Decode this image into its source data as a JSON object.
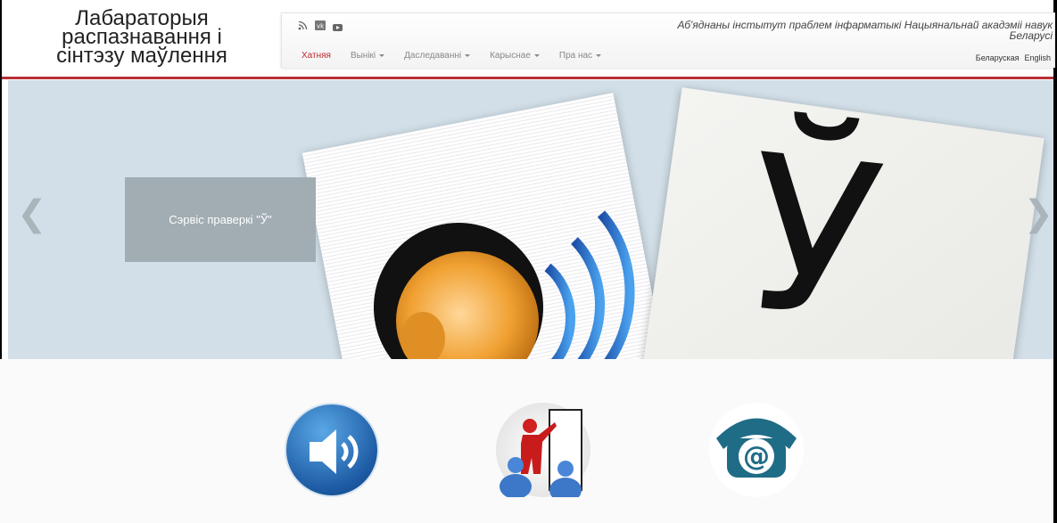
{
  "brand": {
    "line1": "Лабараторыя",
    "line2": "распазнавання і",
    "line3": "сінтэзу маўлення"
  },
  "institute": {
    "line1": "Аб'яднаны інстытут праблем інфарматыкі Нацыянальнай акадэміі навук",
    "line2": "Беларусі"
  },
  "social_icons": [
    "rss-icon",
    "vk-icon",
    "youtube-icon"
  ],
  "nav": {
    "items": [
      {
        "label": "Хатняя",
        "active": true,
        "dropdown": false
      },
      {
        "label": "Вынікі",
        "active": false,
        "dropdown": true
      },
      {
        "label": "Даследаванні",
        "active": false,
        "dropdown": true
      },
      {
        "label": "Карыснае",
        "active": false,
        "dropdown": true
      },
      {
        "label": "Пра нас",
        "active": false,
        "dropdown": true
      }
    ]
  },
  "languages": [
    "Беларуская",
    "English"
  ],
  "carousel": {
    "caption": "Сэрвіс праверкі \"Ў\"",
    "prev_label": "❮",
    "next_label": "❯",
    "slide_letter": "Ў"
  },
  "services": [
    {
      "icon": "speaker-icon"
    },
    {
      "icon": "lecturer-icon"
    },
    {
      "icon": "email-phone-icon"
    }
  ],
  "colors": {
    "accent_red": "#c0282e",
    "rule_red": "#b83035",
    "carousel_bg": "#d2dfe8",
    "caption_bg": "#a1adb3"
  }
}
